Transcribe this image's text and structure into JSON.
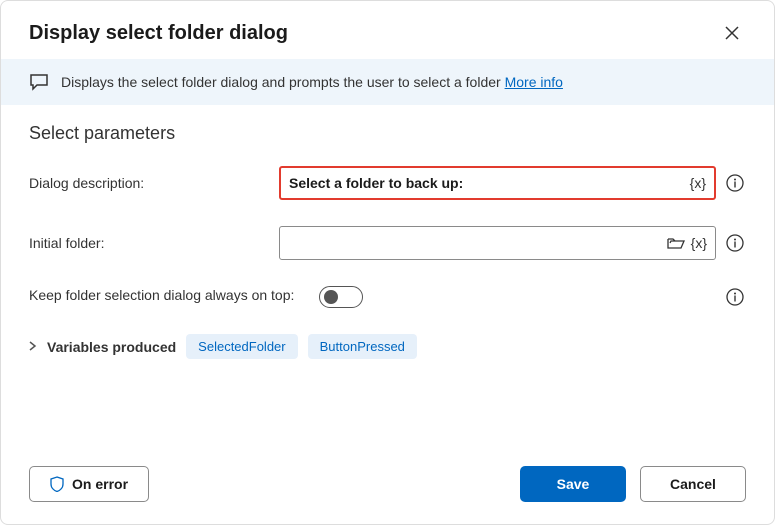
{
  "header": {
    "title": "Display select folder dialog"
  },
  "banner": {
    "text": "Displays the select folder dialog and prompts the user to select a folder ",
    "more_info": "More info"
  },
  "section": {
    "title": "Select parameters"
  },
  "fields": {
    "dialog_description": {
      "label": "Dialog description:",
      "value": "Select a folder to back up:"
    },
    "initial_folder": {
      "label": "Initial folder:",
      "value": ""
    },
    "keep_on_top": {
      "label": "Keep folder selection dialog always on top:",
      "value": false
    }
  },
  "variables": {
    "label": "Variables produced",
    "chips": [
      "SelectedFolder",
      "ButtonPressed"
    ]
  },
  "footer": {
    "on_error": "On error",
    "save": "Save",
    "cancel": "Cancel"
  },
  "icons": {
    "var_placeholder": "{x}"
  }
}
